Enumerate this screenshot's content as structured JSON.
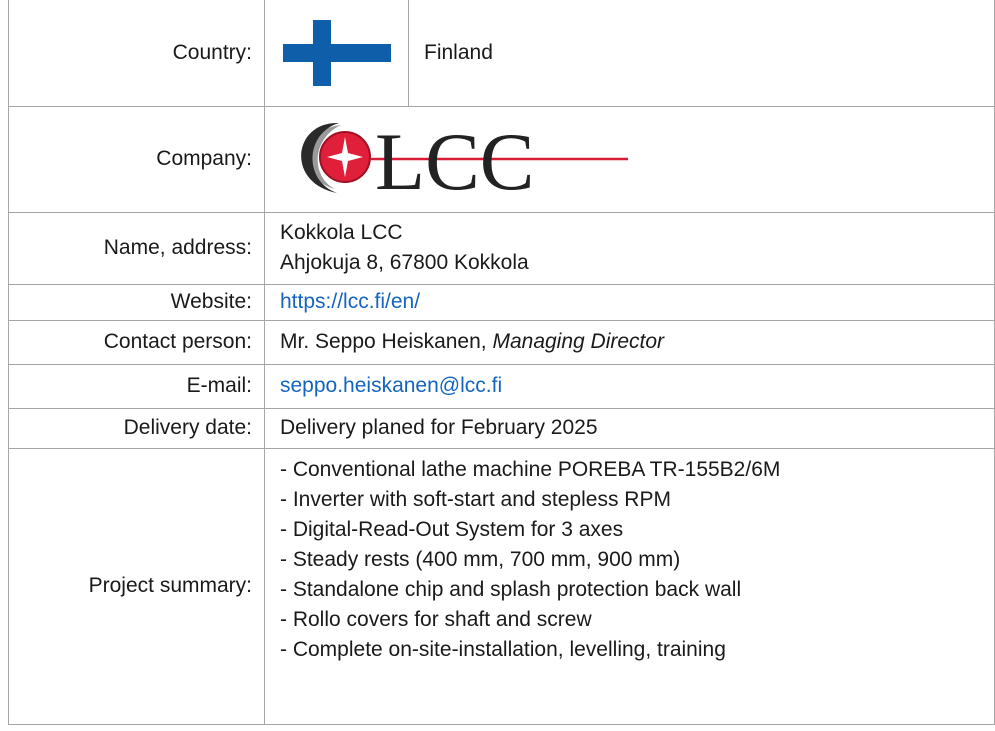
{
  "country": {
    "label": "Country:",
    "value": "Finland",
    "flag_icon": "finland-flag-icon",
    "flag_colors": {
      "white": "#ffffff",
      "blue": "#0f5ea9"
    }
  },
  "company": {
    "label": "Company:",
    "logo_text": "LCC",
    "logo_colors": {
      "red": "#e0203a",
      "dark": "#222222",
      "gray": "#9a9a9a",
      "line": "#d81b36"
    }
  },
  "name_address": {
    "label": "Name, address:",
    "line1": "Kokkola LCC",
    "line2": "Ahjokuja 8, 67800 Kokkola"
  },
  "website": {
    "label": "Website:",
    "url": "https://lcc.fi/en/"
  },
  "contact": {
    "label": "Contact person:",
    "name": "Mr. Seppo Heiskanen,",
    "role": "Managing Director"
  },
  "email": {
    "label": "E-mail:",
    "address": "seppo.heiskanen@lcc.fi"
  },
  "delivery": {
    "label": "Delivery date:",
    "value": "Delivery planed for February 2025"
  },
  "summary": {
    "label": "Project summary:",
    "items": [
      "- Conventional lathe machine POREBA TR-155B2/6M",
      "- Inverter with soft-start and stepless RPM",
      "- Digital-Read-Out System for 3 axes",
      "- Steady rests (400 mm, 700 mm, 900 mm)",
      "- Standalone chip and splash protection back wall",
      "- Rollo covers for shaft and screw",
      "- Complete on-site-installation, levelling, training"
    ]
  }
}
